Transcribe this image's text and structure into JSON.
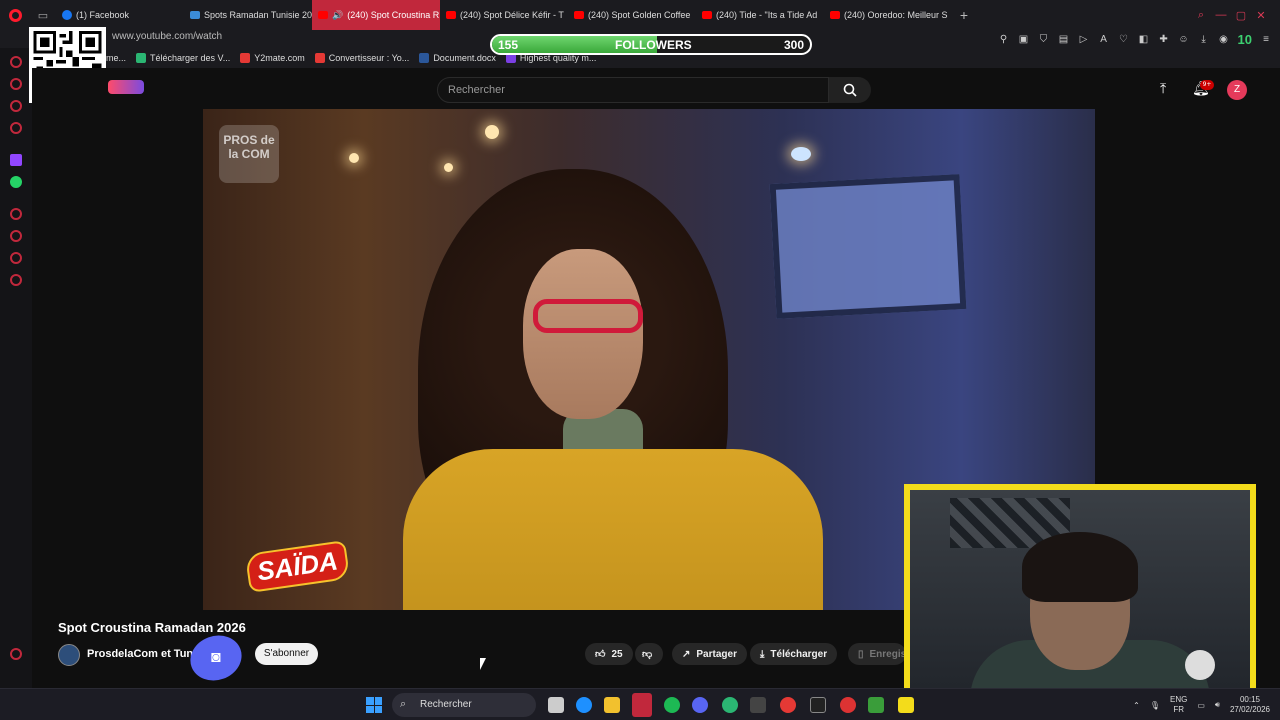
{
  "browser": {
    "tabs": [
      {
        "label": "(1) Facebook",
        "icon": "facebook-icon"
      },
      {
        "label": "Spots Ramadan Tunisie 20",
        "icon": "blue-site-icon"
      },
      {
        "label": "(240) Spot Croustina R",
        "icon": "youtube-icon",
        "active": true
      },
      {
        "label": "(240) Spot Délice Kéfir - T",
        "icon": "youtube-icon"
      },
      {
        "label": "(240) Spot Golden Coffee",
        "icon": "youtube-icon"
      },
      {
        "label": "(240) Tide - \"Its a Tide Ad",
        "icon": "youtube-icon"
      },
      {
        "label": "(240) Ooredoo: Meilleur S",
        "icon": "youtube-icon"
      }
    ],
    "url": "www.youtube.com/watch",
    "extension_badge": "10",
    "bookmarks": [
      {
        "label": "me...",
        "color": "#444444"
      },
      {
        "label": "Télécharger des V...",
        "color": "#2bb673"
      },
      {
        "label": "Y2mate.com",
        "color": "#e53935"
      },
      {
        "label": "Convertisseur : Yo...",
        "color": "#e53935"
      },
      {
        "label": "Document.docx",
        "color": "#2b579a"
      },
      {
        "label": "Highest quality m...",
        "color": "#7b3fe4"
      }
    ]
  },
  "followers_goal": {
    "current": "155",
    "label": "FOLLOWERS",
    "target": "300",
    "progress": 0.52
  },
  "youtube": {
    "search_placeholder": "Rechercher",
    "notification_count": "9+",
    "avatar_letter": "Z",
    "video": {
      "watermark": "PROS de la COM",
      "brand_logo": "SAÏDA",
      "title": "Spot Croustina Ramadan 2026",
      "channel": "ProsdelaCom et Tunisie",
      "subscribe_label": "S'abonner",
      "likes": "25",
      "share_label": "Partager",
      "download_label": "Télécharger",
      "save_label": "Enregis"
    }
  },
  "taskbar": {
    "search_label": "Rechercher",
    "lang_top": "ENG",
    "lang_bottom": "FR",
    "time": "00:15",
    "date": "27/02/2026"
  },
  "colors": {
    "accent": "#c1283c",
    "followers_fill": "#4cbc4c",
    "webcam_border": "#f3dc1b",
    "discord": "#5865f2"
  }
}
